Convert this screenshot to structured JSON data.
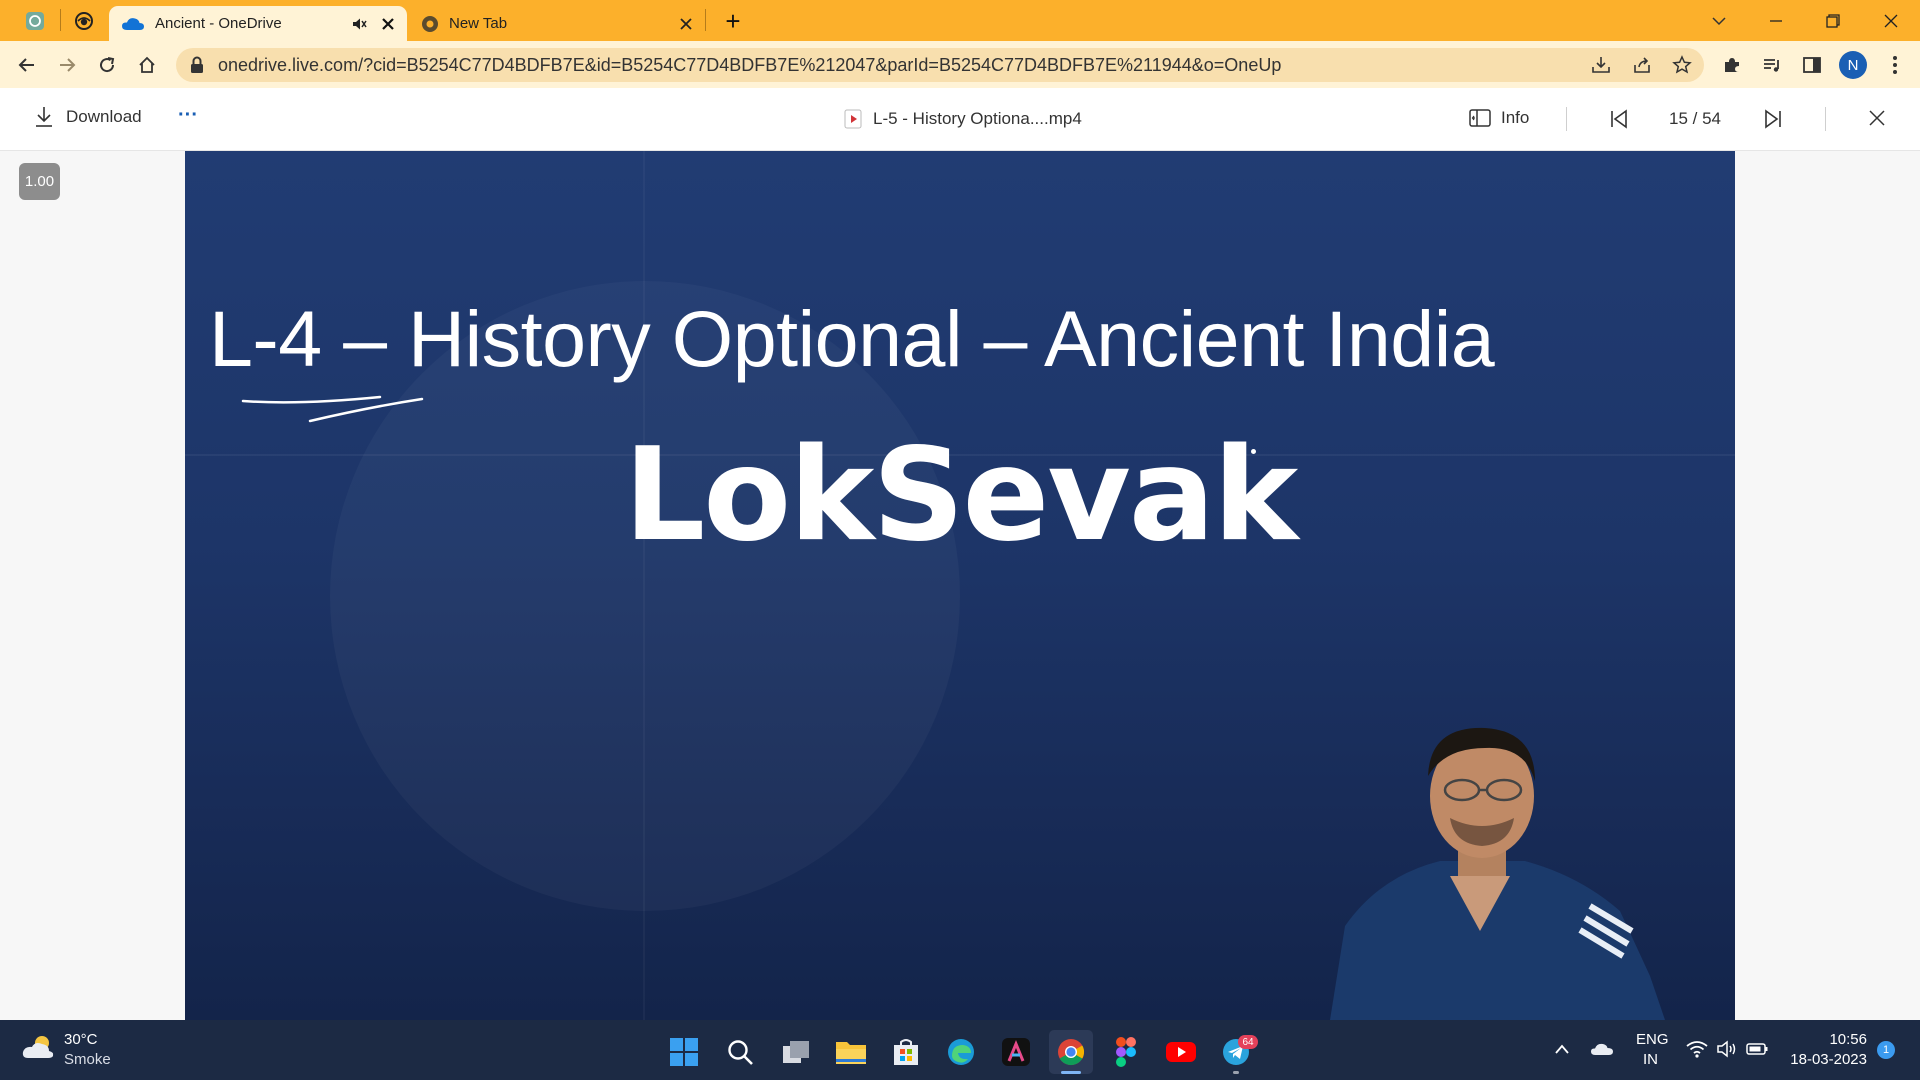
{
  "browser": {
    "tabs": [
      {
        "title": "Ancient - OneDrive",
        "icon": "onedrive-cloud-icon",
        "audio_icon": "speaker-muted-icon",
        "active": true
      },
      {
        "title": "New Tab",
        "icon": "chrome-icon",
        "active": false
      }
    ],
    "new_tab": "+",
    "url": "onedrive.live.com/?cid=B5254C77D4BDFB7E&id=B5254C77D4BDFB7E%212047&parId=B5254C77D4BDFB7E%211944&o=OneUp",
    "profile_initial": "N",
    "accent": "#fcb02b"
  },
  "viewer": {
    "download_label": "Download",
    "more_label": "···",
    "file_name": "L-5 - History Optiona....mp4",
    "info_label": "Info",
    "position": "15 / 54",
    "playback_speed": "1.00"
  },
  "video": {
    "lecture_title": "L-4 – History Optional – Ancient India",
    "brand": "LokSevak"
  },
  "taskbar": {
    "weather_temp": "30°C",
    "weather_desc": "Smoke",
    "language": "ENG",
    "region": "IN",
    "time": "10:56",
    "date": "18-03-2023",
    "telegram_badge": "64",
    "notification_count": "1"
  }
}
